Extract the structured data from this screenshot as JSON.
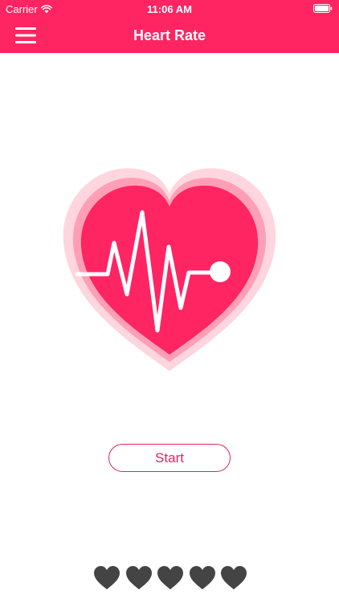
{
  "status_bar": {
    "carrier": "Carrier",
    "time": "11:06 AM",
    "icons": [
      "wifi-icon",
      "battery-icon"
    ]
  },
  "nav": {
    "title": "Heart Rate",
    "menu_icon": "hamburger-menu-icon"
  },
  "hero": {
    "icon": "heart-pulse-icon"
  },
  "actions": {
    "start_label": "Start"
  },
  "rating": {
    "icon": "heart-icon",
    "filled": 5,
    "total": 5
  },
  "colors": {
    "accent": "#ff2462",
    "heart_outer": "#ffd5df",
    "heart_middle": "#ff9fb6",
    "heart_inner": "#ff2462",
    "rating_heart": "#444444",
    "white": "#ffffff"
  }
}
